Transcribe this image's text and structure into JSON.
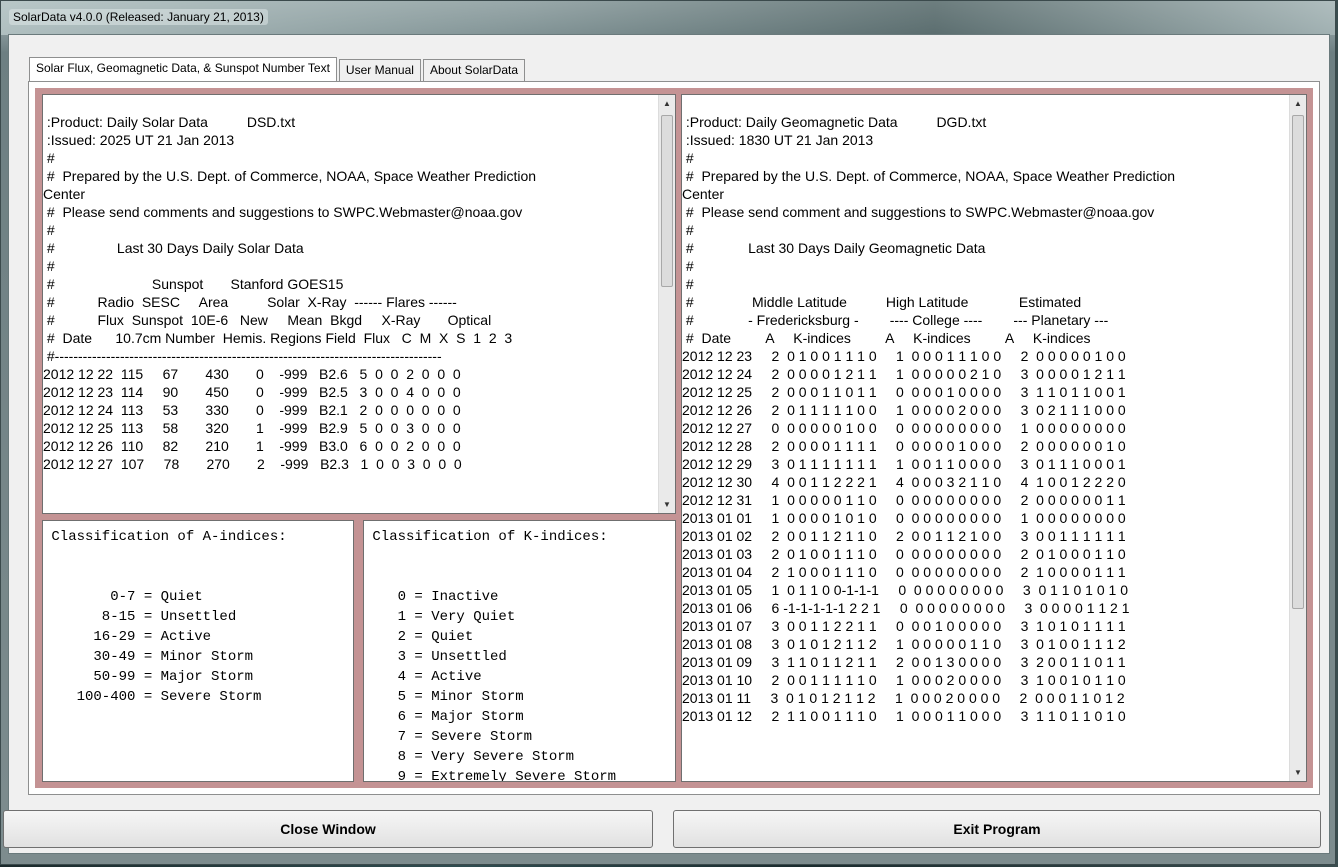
{
  "window": {
    "title": "SolarData v4.0.0 (Released:  January 21, 2013)"
  },
  "tabs": [
    {
      "label": "Solar Flux, Geomagnetic Data, & Sunspot Number Text"
    },
    {
      "label": "User Manual"
    },
    {
      "label": "About SolarData"
    }
  ],
  "solar_text": {
    "lines": [
      "",
      " :Product: Daily Solar Data          DSD.txt",
      " :Issued: 2025 UT 21 Jan 2013",
      " #",
      " #  Prepared by the U.S. Dept. of Commerce, NOAA, Space Weather Prediction",
      "Center",
      " #  Please send comments and suggestions to SWPC.Webmaster@noaa.gov",
      " #",
      " #                Last 30 Days Daily Solar Data",
      " #",
      " #                         Sunspot       Stanford GOES15",
      " #           Radio  SESC     Area          Solar  X-Ray  ------ Flares ------",
      " #           Flux  Sunspot  10E-6   New     Mean  Bkgd     X-Ray       Optical",
      " #  Date      10.7cm Number  Hemis. Regions Field  Flux   C  M  X  S  1  2  3",
      " #-----------------------------------------------------------------------------------",
      "2012 12 22  115     67       430       0    -999   B2.6   5  0  0  2  0  0  0",
      "2012 12 23  114     90       450       0    -999   B2.5   3  0  0  4  0  0  0",
      "2012 12 24  113     53       330       0    -999   B2.1   2  0  0  0  0  0  0",
      "2012 12 25  113     58       320       1    -999   B2.9   5  0  0  3  0  0  0",
      "2012 12 26  110     82       210       1    -999   B3.0   6  0  0  2  0  0  0",
      "2012 12 27  107     78       270       2    -999   B2.3   1  0  0  3  0  0  0"
    ]
  },
  "geo_text": {
    "lines": [
      "",
      " :Product: Daily Geomagnetic Data          DGD.txt",
      " :Issued: 1830 UT 21 Jan 2013",
      " #",
      " #  Prepared by the U.S. Dept. of Commerce, NOAA, Space Weather Prediction",
      "Center",
      " #  Please send comment and suggestions to SWPC.Webmaster@noaa.gov",
      " #",
      " #              Last 30 Days Daily Geomagnetic Data",
      " #",
      " #",
      " #               Middle Latitude          High Latitude             Estimated",
      " #              - Fredericksburg -        ---- College ----        --- Planetary ---",
      " #  Date         A     K-indices         A     K-indices         A     K-indices",
      "2012 12 23     2  0 1 0 0 1 1 1 0     1  0 0 0 1 1 1 0 0     2  0 0 0 0 0 1 0 0",
      "2012 12 24     2  0 0 0 0 1 2 1 1     1  0 0 0 0 0 2 1 0     3  0 0 0 0 1 2 1 1",
      "2012 12 25     2  0 0 0 1 1 0 1 1     0  0 0 0 1 0 0 0 0     3  1 1 0 1 1 0 0 1",
      "2012 12 26     2  0 1 1 1 1 1 0 0     1  0 0 0 0 2 0 0 0     3  0 2 1 1 1 0 0 0",
      "2012 12 27     0  0 0 0 0 0 1 0 0     0  0 0 0 0 0 0 0 0     1  0 0 0 0 0 0 0 0",
      "2012 12 28     2  0 0 0 0 1 1 1 1     0  0 0 0 0 1 0 0 0     2  0 0 0 0 0 0 1 0",
      "2012 12 29     3  0 1 1 1 1 1 1 1     1  0 0 1 1 0 0 0 0     3  0 1 1 1 0 0 0 1",
      "2012 12 30     4  0 0 1 1 2 2 2 1     4  0 0 0 3 2 1 1 0     4  1 0 0 1 2 2 2 0",
      "2012 12 31     1  0 0 0 0 0 1 1 0     0  0 0 0 0 0 0 0 0     2  0 0 0 0 0 0 1 1",
      "2013 01 01     1  0 0 0 0 1 0 1 0     0  0 0 0 0 0 0 0 0     1  0 0 0 0 0 0 0 0",
      "2013 01 02     2  0 0 1 1 2 1 1 0     2  0 0 1 1 2 1 0 0     3  0 0 1 1 1 1 1 1",
      "2013 01 03     2  0 1 0 0 1 1 1 0     0  0 0 0 0 0 0 0 0     2  0 1 0 0 0 1 1 0",
      "2013 01 04     2  1 0 0 0 1 1 1 0     0  0 0 0 0 0 0 0 0     2  1 0 0 0 0 1 1 1",
      "2013 01 05     1  0 1 1 0 0-1-1-1     0  0 0 0 0 0 0 0 0     3  0 1 1 0 1 0 1 0",
      "2013 01 06     6 -1-1-1-1-1 2 2 1     0  0 0 0 0 0 0 0 0     3  0 0 0 0 1 1 2 1",
      "2013 01 07     3  0 0 1 1 2 2 1 1     0  0 0 1 0 0 0 0 0     3  1 0 1 0 1 1 1 1",
      "2013 01 08     3  0 1 0 1 2 1 1 2     1  0 0 0 0 0 1 1 0     3  0 1 0 0 1 1 1 2",
      "2013 01 09     3  1 1 0 1 1 2 1 1     2  0 0 1 3 0 0 0 0     3  2 0 0 1 1 0 1 1",
      "2013 01 10     2  0 0 1 1 1 1 1 0     1  0 0 0 2 0 0 0 0     3  1 0 0 1 0 1 1 0",
      "2013 01 11     3  0 1 0 1 2 1 1 2     1  0 0 0 2 0 0 0 0     2  0 0 0 1 1 0 1 2",
      "2013 01 12     2  1 1 0 0 1 1 1 0     1  0 0 0 1 1 0 0 0     3  1 1 0 1 1 0 1 0"
    ]
  },
  "a_indices": {
    "lines": [
      " Classification of A-indices:",
      "",
      "",
      "        0-7 = Quiet",
      "       8-15 = Unsettled",
      "      16-29 = Active",
      "      30-49 = Minor Storm",
      "      50-99 = Major Storm",
      "    100-400 = Severe Storm"
    ]
  },
  "k_indices": {
    "lines": [
      " Classification of K-indices:",
      "",
      "",
      "    0 = Inactive",
      "    1 = Very Quiet",
      "    2 = Quiet",
      "    3 = Unsettled",
      "    4 = Active",
      "    5 = Minor Storm",
      "    6 = Major Storm",
      "    7 = Severe Storm",
      "    8 = Very Severe Storm",
      "    9 = Extremely Severe Storm"
    ]
  },
  "buttons": {
    "close": "Close Window",
    "exit": "Exit Program"
  }
}
